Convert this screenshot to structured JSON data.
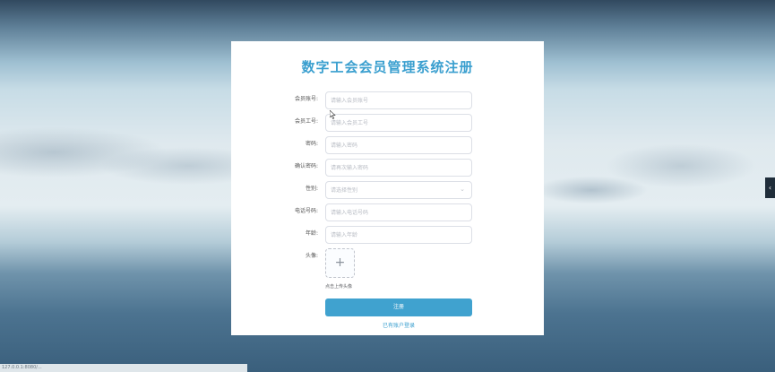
{
  "page": {
    "title": "数字工会会员管理系统注册"
  },
  "form": {
    "fields": [
      {
        "label": "会员账号:",
        "placeholder": "请输入会员账号"
      },
      {
        "label": "会员工号:",
        "placeholder": "请输入会员工号"
      },
      {
        "label": "密码:",
        "placeholder": "请输入密码"
      },
      {
        "label": "确认密码:",
        "placeholder": "请再次输入密码"
      },
      {
        "label": "性别:",
        "placeholder": "请选择性别"
      },
      {
        "label": "电话号码:",
        "placeholder": "请输入电话号码"
      },
      {
        "label": "年龄:",
        "placeholder": "请输入年龄"
      }
    ],
    "avatar": {
      "label": "头像:",
      "plus": "+",
      "hint": "点击上传头像"
    },
    "submit_label": "注册",
    "login_link": "已有账户登录"
  },
  "side_tab": {
    "icon": "chevron-left-icon",
    "glyph": "‹"
  },
  "status_bar": {
    "url": "127.0.0.1:8080/..."
  },
  "colors": {
    "accent": "#3a9fcf",
    "button": "#40a2cf",
    "card": "#ffffff"
  }
}
